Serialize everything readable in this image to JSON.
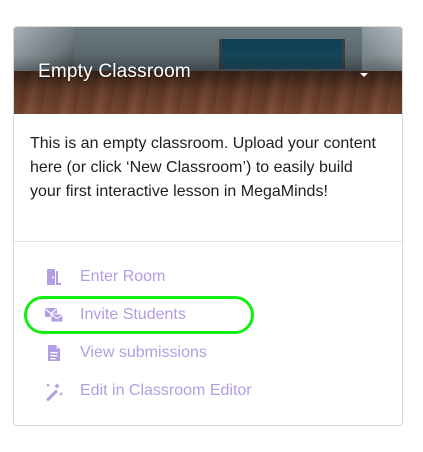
{
  "card": {
    "title": "Empty Classroom",
    "description": "This is an empty classroom. Upload your content here (or click ‘New Classroom’) to easily build your first interactive lesson in MegaMinds!"
  },
  "actions": [
    {
      "label": "Enter Room",
      "icon": "door-icon"
    },
    {
      "label": "Invite Students",
      "icon": "invite-icon",
      "highlighted": true
    },
    {
      "label": "View submissions",
      "icon": "document-icon"
    },
    {
      "label": "Edit in Classroom Editor",
      "icon": "magic-wand-icon"
    }
  ],
  "colors": {
    "action_text": "#b29ee3",
    "highlight": "#11ee11",
    "description_text": "#1f1f1f"
  }
}
